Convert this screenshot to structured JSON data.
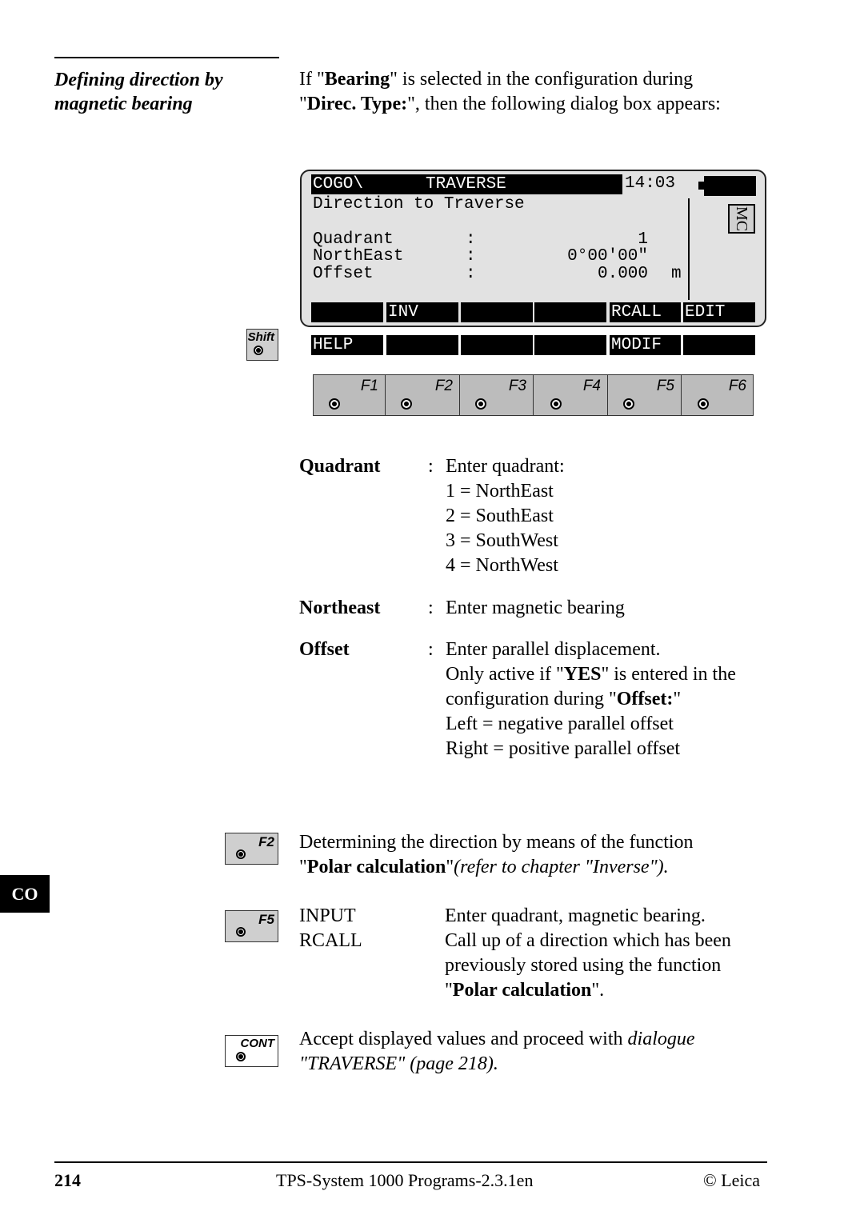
{
  "section": {
    "heading_line1": "Defining direction by",
    "heading_line2": "magnetic bearing"
  },
  "intro": {
    "p1_a": "If \"",
    "p1_b": "Bearing",
    "p1_c": "\" is selected in the configuration during",
    "p2_a": "\"",
    "p2_b": "Direc. Type:",
    "p2_c": "\", then the following dialog box appears:"
  },
  "screen": {
    "title_left": "COGO\\",
    "title_center": "TRAVERSE",
    "time": "14:03",
    "subtitle": "Direction to Traverse",
    "mc_label": "MC",
    "fields": [
      {
        "label": "Quadrant",
        "colon": ":",
        "value": "1",
        "unit": ""
      },
      {
        "label": "NorthEast",
        "colon": ":",
        "value": "0°00'00\"",
        "unit": ""
      },
      {
        "label": "Offset",
        "colon": ":",
        "value": "0.000",
        "unit": "m"
      }
    ],
    "softkeys": [
      "",
      "INV",
      "",
      "",
      "RCALL",
      "EDIT"
    ],
    "shift_softkeys": [
      "HELP",
      "",
      "",
      "",
      "MODIF",
      ""
    ]
  },
  "shift_key": "Shift",
  "function_keys": [
    "F1",
    "F2",
    "F3",
    "F4",
    "F5",
    "F6"
  ],
  "descriptions": [
    {
      "term": "Quadrant",
      "lines": [
        "Enter quadrant:",
        "1 = NorthEast",
        "2 = SouthEast",
        "3 = SouthWest",
        "4 = NorthWest"
      ]
    },
    {
      "term": "Northeast",
      "lines": [
        "Enter magnetic bearing"
      ]
    },
    {
      "term": "Offset",
      "lines": [
        "Enter parallel displacement."
      ],
      "l2_a": "Only active if \"",
      "l2_b": "YES",
      "l2_c": "\" is entered in the",
      "l3_a": "configuration during \"",
      "l3_b": "Offset:",
      "l3_c": "\"",
      "l4": "Left = negative parallel offset",
      "l5": "Right = positive parallel offset"
    }
  ],
  "f2_note": {
    "key": "F2",
    "line1": "Determining the direction by means of the function",
    "l2_a": "\"",
    "l2_b": "Polar calculation",
    "l2_c": "\"",
    "l2_d": "(refer to chapter \"Inverse\")."
  },
  "f5_note": {
    "key": "F5",
    "items": [
      {
        "term": "INPUT",
        "text": "Enter quadrant, magnetic bearing."
      },
      {
        "term": "RCALL",
        "text": "Call up of a direction which has been"
      }
    ],
    "l3": "previously stored using the function",
    "l4_a": "\"",
    "l4_b": "Polar calculation",
    "l4_c": "\"."
  },
  "cont_note": {
    "key": "CONT",
    "l1_a": "Accept displayed values and proceed with ",
    "l1_b": "dialogue",
    "l2": "\"TRAVERSE\" (page 218)."
  },
  "tab": "CO",
  "footer": {
    "page": "214",
    "title": "TPS-System 1000 Programs-2.3.1en",
    "copyright": "© Leica"
  }
}
